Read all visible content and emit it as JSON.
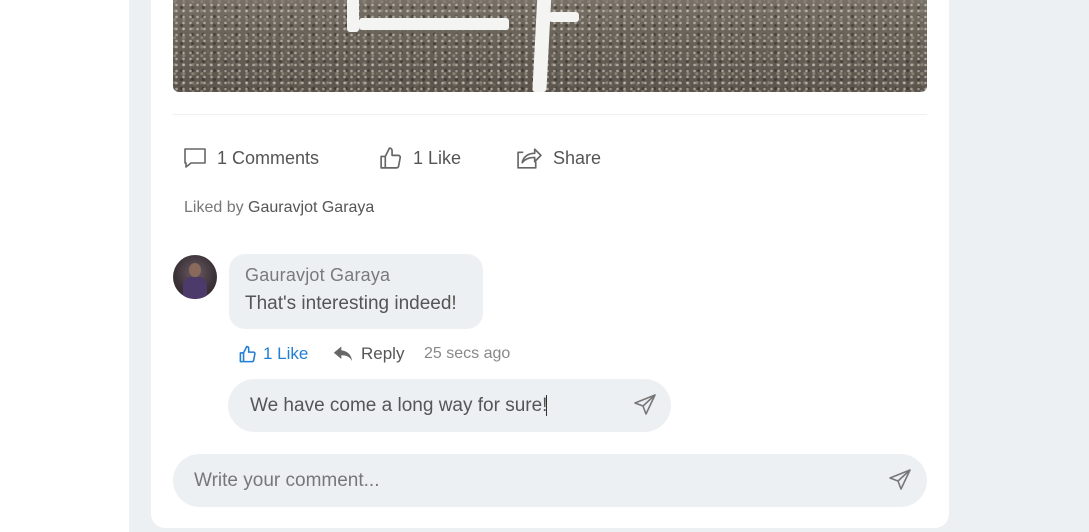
{
  "post": {
    "comments_label": "1 Comments",
    "likes_label": "1 Like",
    "share_label": "Share",
    "liked_by_prefix": "Liked by",
    "liked_by_name": "Gauravjot Garaya"
  },
  "comment": {
    "author": "Gauravjot Garaya",
    "text": "That's interesting indeed!",
    "like_label": "1 Like",
    "reply_label": "Reply",
    "time": "25 secs ago"
  },
  "reply_input": {
    "value": "We have come a long way for sure!"
  },
  "comment_input": {
    "placeholder": "Write your comment..."
  },
  "colors": {
    "page_bg": "#edf0f3",
    "card_bg": "#ffffff",
    "accent": "#1f7fd4"
  },
  "icons": {
    "comments": "comment-icon",
    "like": "thumbs-up-icon",
    "share": "share-icon",
    "reply": "reply-icon",
    "send": "send-icon"
  }
}
